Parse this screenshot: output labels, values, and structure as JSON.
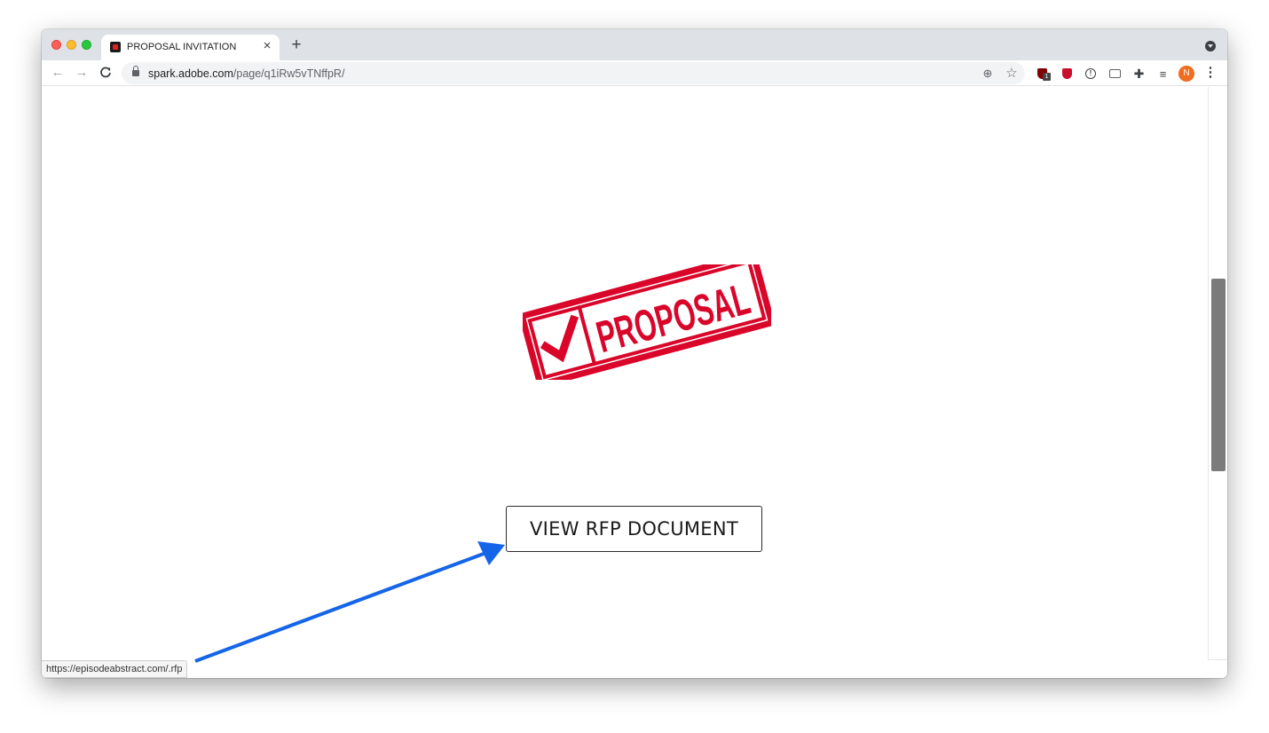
{
  "browser": {
    "tab": {
      "title": "PROPOSAL INVITATION",
      "close_glyph": "×",
      "favicon": "adobe-spark-favicon"
    },
    "new_tab_glyph": "+",
    "nav": {
      "back_glyph": "←",
      "forward_glyph": "→",
      "reload_glyph": "C"
    },
    "address": {
      "host": "spark.adobe.com",
      "path": "/page/q1iRw5vTNffpR/"
    },
    "icons": {
      "zoom": "zoom-icon",
      "star": "bookmark-star-icon",
      "extensions": [
        "ublock-icon",
        "shield-extension-icon",
        "info-extension-icon",
        "chat-extension-icon",
        "extensions-puzzle-icon",
        "media-control-icon"
      ]
    },
    "zoom_glyph": "⊕",
    "star_glyph": "☆",
    "ublock_badge": "1",
    "info_glyph": "!",
    "puzzle_glyph": "✚",
    "media_glyph": "≡",
    "avatar_initial": "N",
    "menu_glyph": "⋮",
    "status_url": "https://episodeabstract.com/.rfp",
    "colors": {
      "avatar": "#f06c1e",
      "tabstrip": "#dee1e6"
    }
  },
  "page": {
    "stamp": {
      "text": "PROPOSAL",
      "color": "#d9062a"
    },
    "cta_label": "VIEW RFP DOCUMENT",
    "annotation": {
      "type": "arrow",
      "color": "#1565e8"
    }
  }
}
